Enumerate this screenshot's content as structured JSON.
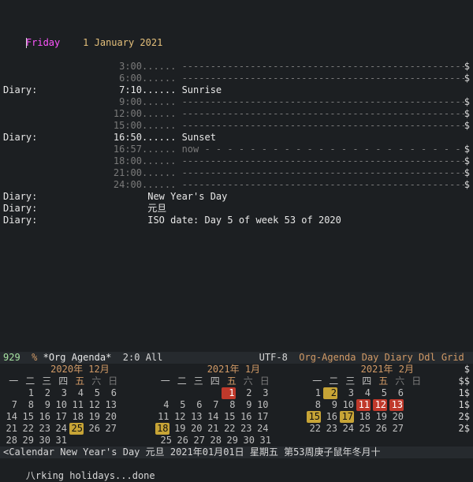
{
  "agenda": {
    "day_name": "Friday",
    "date_header": "1 January 2021",
    "lines": [
      {
        "left": "",
        "time": "3:00",
        "style": "grey",
        "dots": "......",
        "text": "-----------------------------------------------------",
        "eol": "$"
      },
      {
        "left": "",
        "time": "6:00",
        "style": "grey",
        "dots": "......",
        "text": "-----------------------------------------------------",
        "eol": "$"
      },
      {
        "left": "Diary:",
        "time": "7:10",
        "style": "white",
        "dots": "......",
        "text": "Sunrise",
        "eol": ""
      },
      {
        "left": "",
        "time": "9:00",
        "style": "grey",
        "dots": "......",
        "text": "-----------------------------------------------------",
        "eol": "$"
      },
      {
        "left": "",
        "time": "12:00",
        "style": "grey",
        "dots": "......",
        "text": "-----------------------------------------------------",
        "eol": "$"
      },
      {
        "left": "",
        "time": "15:00",
        "style": "grey",
        "dots": "......",
        "text": "-----------------------------------------------------",
        "eol": "$"
      },
      {
        "left": "Diary:",
        "time": "16:50",
        "style": "white",
        "dots": "......",
        "text": "Sunset",
        "eol": ""
      },
      {
        "left": "",
        "time": "16:57",
        "style": "grey",
        "dots": "......",
        "text": "now - - - - - - - - - - - - - - - - - - - - - - - - - -",
        "eol": "$"
      },
      {
        "left": "",
        "time": "18:00",
        "style": "grey",
        "dots": "......",
        "text": "-----------------------------------------------------",
        "eol": "$"
      },
      {
        "left": "",
        "time": "21:00",
        "style": "grey",
        "dots": "......",
        "text": "-----------------------------------------------------",
        "eol": "$"
      },
      {
        "left": "",
        "time": "24:00",
        "style": "grey",
        "dots": "......",
        "text": "-----------------------------------------------------",
        "eol": "$"
      },
      {
        "left": "Diary:",
        "time": "",
        "style": "white",
        "dots": "",
        "text": "New Year's Day",
        "eol": ""
      },
      {
        "left": "Diary:",
        "time": "",
        "style": "white",
        "dots": "",
        "text": "元旦",
        "eol": ""
      },
      {
        "left": "Diary:",
        "time": "",
        "style": "white",
        "dots": "",
        "text": "ISO date: Day 5 of week 53 of 2020",
        "eol": ""
      }
    ]
  },
  "modeline": {
    "line_no": "929",
    "pct": "%",
    "buffer": "*Org Agenda*",
    "cursor": "2:0",
    "all": "All",
    "encoding": "UTF-8",
    "modes": "Org-Agenda Day Diary Ddl Grid"
  },
  "calendar": {
    "months": [
      {
        "title": "2020年 12月",
        "wdays": [
          "一",
          "二",
          "三",
          "四",
          "五",
          "六",
          "日"
        ],
        "weeks": [
          [
            null,
            1,
            2,
            3,
            4,
            5,
            6
          ],
          [
            7,
            8,
            9,
            10,
            11,
            12,
            13
          ],
          [
            14,
            15,
            16,
            17,
            18,
            19,
            20
          ],
          [
            21,
            22,
            23,
            24,
            25,
            26,
            27
          ],
          [
            28,
            29,
            30,
            31,
            null,
            null,
            null
          ]
        ],
        "highlight_yellow": [
          25
        ],
        "highlight_red": []
      },
      {
        "title": "2021年 1月",
        "wdays": [
          "一",
          "二",
          "三",
          "四",
          "五",
          "六",
          "日"
        ],
        "weeks": [
          [
            null,
            null,
            null,
            null,
            1,
            2,
            3
          ],
          [
            4,
            5,
            6,
            7,
            8,
            9,
            10
          ],
          [
            11,
            12,
            13,
            14,
            15,
            16,
            17
          ],
          [
            18,
            19,
            20,
            21,
            22,
            23,
            24
          ],
          [
            25,
            26,
            27,
            28,
            29,
            30,
            31
          ]
        ],
        "highlight_yellow": [
          18
        ],
        "highlight_red": [
          1
        ]
      },
      {
        "title": "2021年 2月",
        "wdays": [
          "一",
          "二",
          "三",
          "四",
          "五",
          "六",
          "日"
        ],
        "weeks": [
          [
            1,
            2,
            3,
            4,
            5,
            6,
            null
          ],
          [
            8,
            9,
            10,
            11,
            12,
            13,
            null
          ],
          [
            15,
            16,
            17,
            18,
            19,
            20,
            null
          ],
          [
            22,
            23,
            24,
            25,
            26,
            27,
            null
          ],
          [
            null,
            null,
            null,
            null,
            null,
            null,
            null
          ]
        ],
        "highlight_yellow": [
          2,
          15,
          17
        ],
        "highlight_red": [
          11,
          12,
          13
        ]
      }
    ],
    "row_end": [
      "$",
      "$$",
      "1$",
      "1$",
      "2$",
      "2$"
    ]
  },
  "calendar_modeline": "<Calendar New Year's Day 元旦 2021年01月01日 星期五 第53周庚子鼠年冬月十",
  "echo_area": "八rking holidays...done"
}
